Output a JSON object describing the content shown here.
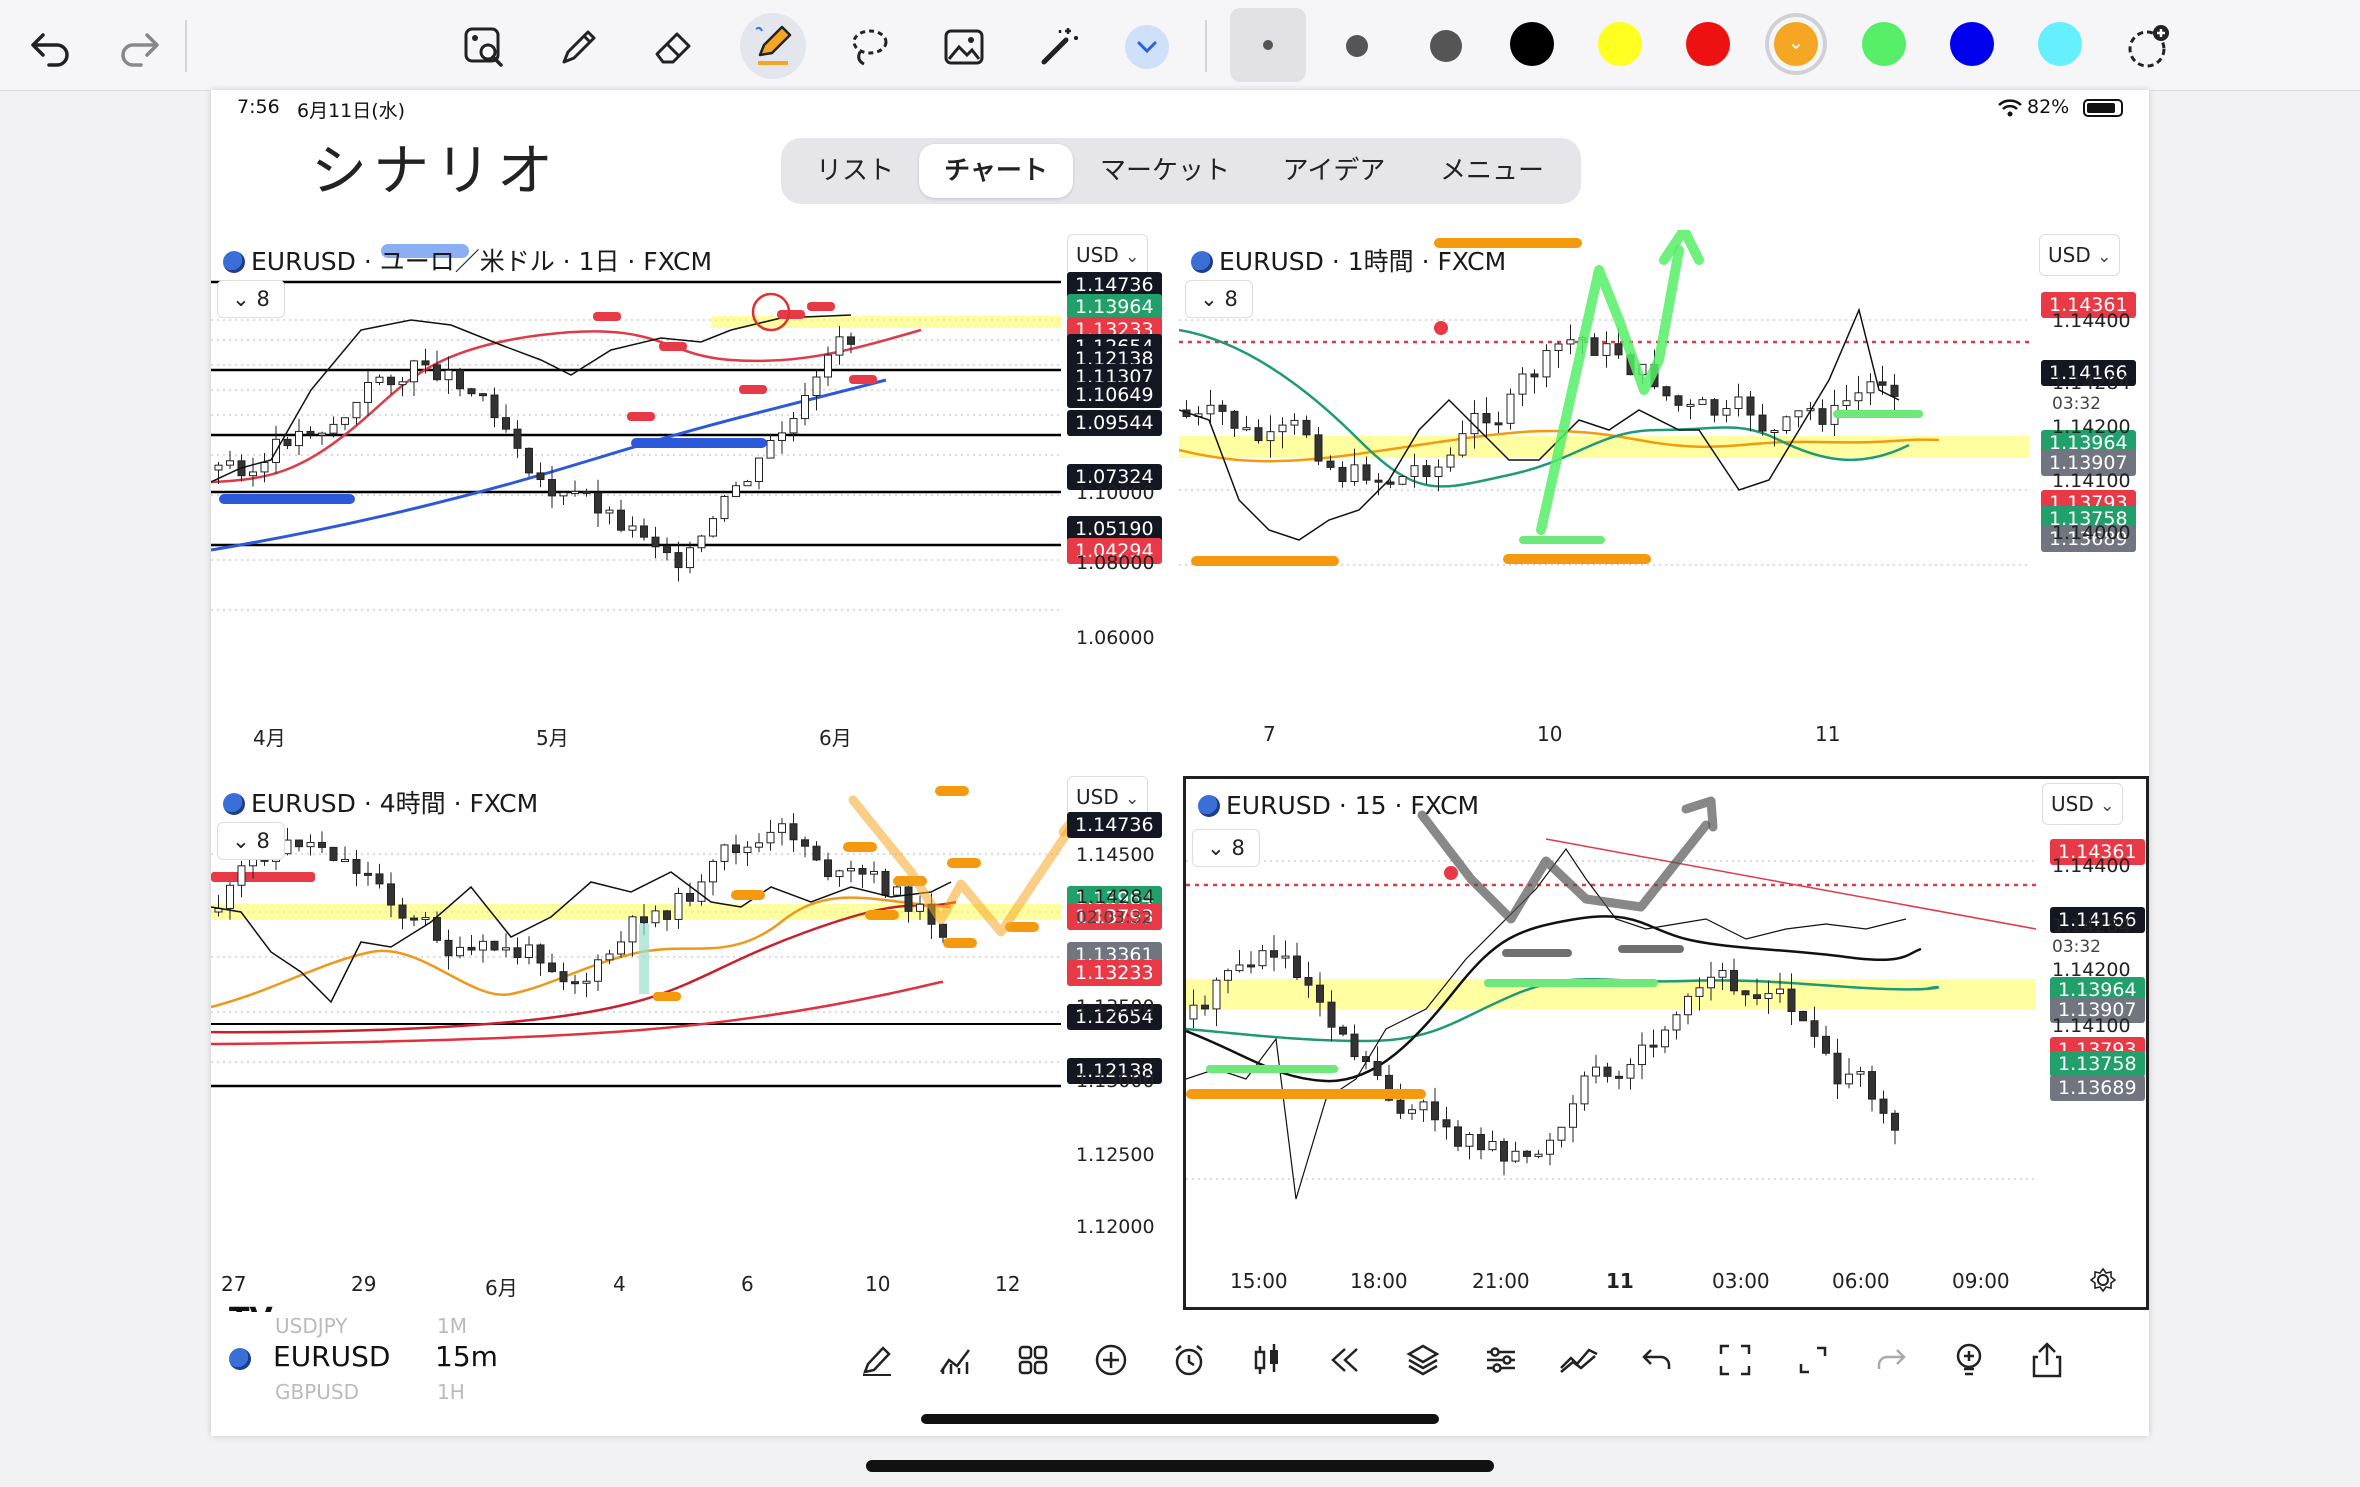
{
  "toolbar": {
    "undo_icon": "undo-icon",
    "redo_icon": "redo-icon",
    "tools": [
      "photo-search-icon",
      "pen-icon",
      "eraser-icon",
      "highlighter-icon",
      "lasso-icon",
      "image-icon",
      "magic-wand-icon",
      "chevron-down-icon"
    ],
    "dot_sizes": [
      "small",
      "medium",
      "large"
    ],
    "colors": [
      "#000000",
      "#ffff22",
      "#ee1111",
      "#f5a623",
      "#55ee66",
      "#0000ee",
      "#66f0ff"
    ],
    "selected_color": "#f5a623"
  },
  "status": {
    "time": "7:56",
    "date": "6月11日(水)",
    "battery": "82%"
  },
  "handwritten_title": "シナリオ",
  "tabs": [
    "リスト",
    "チャート",
    "マーケット",
    "アイデア",
    "メニュー"
  ],
  "active_tab": "チャート",
  "panels": {
    "p1": {
      "title": "EURUSD · ユーロ／米ドル · 1日 · FXCM",
      "currency": "USD",
      "count": "8",
      "prices": [
        {
          "v": "1.14736",
          "c": "pblk"
        },
        {
          "v": "1.13964",
          "c": "pgrn"
        },
        {
          "v": "1.13233",
          "c": "pred"
        },
        {
          "v": "1.12654",
          "c": "pblk"
        },
        {
          "v": "1.12138",
          "c": "pblk"
        },
        {
          "v": "1.11307",
          "c": "pblk"
        },
        {
          "v": "1.10649",
          "c": "pblk"
        },
        {
          "v": "1.09544",
          "c": "pblk"
        },
        {
          "v": "1.07324",
          "c": "pblk"
        },
        {
          "v": "1.05190",
          "c": "pblk"
        },
        {
          "v": "1.04294",
          "c": "pred"
        }
      ],
      "axis": [
        "1.10000",
        "1.08000",
        "1.06000"
      ],
      "xlabels": [
        "4月",
        "5月",
        "6月"
      ]
    },
    "p2": {
      "title": "EURUSD · 1時間 · FXCM",
      "currency": "USD",
      "count": "8",
      "prices": [
        {
          "v": "1.14361",
          "c": "pred"
        },
        {
          "v": "1.14166",
          "c": "pblk"
        },
        {
          "v": "1.13964",
          "c": "pgrn"
        },
        {
          "v": "1.13907",
          "c": "pgry"
        },
        {
          "v": "1.13793",
          "c": "pred"
        },
        {
          "v": "1.13758",
          "c": "pgrn"
        },
        {
          "v": "1.13689",
          "c": "pgry"
        }
      ],
      "axis": [
        "1.14400",
        "1.14284",
        "03:32",
        "1.14200",
        "1.14100",
        "1.14000"
      ],
      "xlabels": [
        "7",
        "10",
        "11"
      ]
    },
    "p3": {
      "title": "EURUSD · 4時間 · FXCM",
      "currency": "USD",
      "count": "8",
      "prices": [
        {
          "v": "1.14736",
          "c": "pblk"
        },
        {
          "v": "1.13964",
          "c": "pgrn"
        },
        {
          "v": "1.13793",
          "c": "pred"
        },
        {
          "v": "1.13361",
          "c": "pgry"
        },
        {
          "v": "1.13233",
          "c": "pred"
        },
        {
          "v": "1.12654",
          "c": "pblk"
        },
        {
          "v": "1.12138",
          "c": "pblk"
        }
      ],
      "axis": [
        "1.14500",
        "1.14284",
        "02:03:32",
        "1.13500",
        "1.13000",
        "1.12500",
        "1.12000"
      ],
      "xlabels": [
        "27",
        "29",
        "6月",
        "4",
        "6",
        "10",
        "12"
      ]
    },
    "p4": {
      "title": "EURUSD · 15 · FXCM",
      "currency": "USD",
      "count": "8",
      "prices": [
        {
          "v": "1.14361",
          "c": "pred"
        },
        {
          "v": "1.14166",
          "c": "pblk"
        },
        {
          "v": "1.13964",
          "c": "pgrn"
        },
        {
          "v": "1.13907",
          "c": "pgry"
        },
        {
          "v": "1.13793",
          "c": "pred"
        },
        {
          "v": "1.13758",
          "c": "pgrn"
        },
        {
          "v": "1.13689",
          "c": "pgry"
        }
      ],
      "axis": [
        "1.14400",
        "1.14284",
        "03:32",
        "1.14200",
        "1.14100"
      ],
      "xlabels": [
        "15:00",
        "18:00",
        "21:00",
        "11",
        "03:00",
        "06:00",
        "09:00"
      ]
    }
  },
  "bottom": {
    "symbol": "EURUSD",
    "interval": "15m",
    "ghost_above": "USDJPY",
    "ghost_above_int": "1M",
    "ghost_below": "GBPUSD",
    "ghost_below_int": "1H",
    "logo": "TV"
  }
}
